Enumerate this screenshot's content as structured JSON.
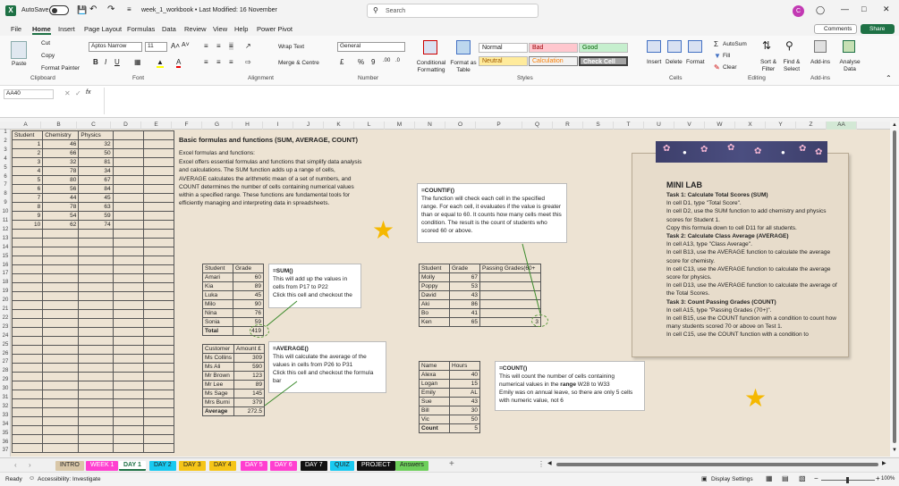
{
  "titlebar": {
    "autosave_label": "AutoSave",
    "autosave_state": "Off",
    "title": "week_1_workbook • Last Modified: 16 November",
    "search_placeholder": "Search",
    "avatar_initial": "C"
  },
  "menu": [
    "File",
    "Home",
    "Insert",
    "Page Layout",
    "Formulas",
    "Data",
    "Review",
    "View",
    "Help",
    "Power Pivot"
  ],
  "menu_active": "Home",
  "menu_right": {
    "comments": "Comments",
    "share": "Share"
  },
  "ribbon": {
    "clipboard": {
      "paste": "Paste",
      "cut": "Cut",
      "copy": "Copy",
      "format_painter": "Format Painter",
      "label": "Clipboard"
    },
    "font": {
      "name": "Aptos Narrow",
      "size": "11",
      "label": "Font"
    },
    "alignment": {
      "wrap": "Wrap Text",
      "merge": "Merge & Centre",
      "label": "Alignment"
    },
    "number": {
      "format": "General",
      "label": "Number"
    },
    "styles": {
      "cond": "Conditional Formatting",
      "table": "Format as Table",
      "normal": "Normal",
      "bad": "Bad",
      "good": "Good",
      "neutral": "Neutral",
      "calc": "Calculation",
      "check": "Check Cell",
      "label": "Styles"
    },
    "cells": {
      "insert": "Insert",
      "delete": "Delete",
      "format": "Format",
      "label": "Cells"
    },
    "editing": {
      "autosum": "AutoSum",
      "fill": "Fill",
      "clear": "Clear",
      "sort": "Sort & Filter",
      "find": "Find & Select",
      "label": "Editing"
    },
    "addins": {
      "addins": "Add-ins",
      "analyse": "Analyse Data",
      "label": "Add-ins"
    }
  },
  "formula_bar": {
    "name_box": "AA40",
    "fx": "fx",
    "value": ""
  },
  "columns": [
    "A",
    "B",
    "C",
    "D",
    "E",
    "F",
    "G",
    "H",
    "I",
    "J",
    "K",
    "L",
    "M",
    "N",
    "O",
    "P",
    "Q",
    "R",
    "S",
    "T",
    "U",
    "V",
    "W",
    "X",
    "Y",
    "Z",
    "AA"
  ],
  "rows": [
    "1",
    "2",
    "3",
    "4",
    "5",
    "6",
    "7",
    "8",
    "9",
    "10",
    "11",
    "12",
    "13",
    "14",
    "15",
    "16",
    "17",
    "18",
    "19",
    "20",
    "21",
    "22",
    "23",
    "24",
    "25",
    "26",
    "27",
    "28",
    "29",
    "30",
    "31",
    "32",
    "33",
    "34",
    "35",
    "36",
    "37"
  ],
  "table_main": {
    "headers": [
      "Student",
      "Chemistry",
      "Physics"
    ],
    "rows": [
      [
        "1",
        "46",
        "32"
      ],
      [
        "2",
        "66",
        "50"
      ],
      [
        "3",
        "32",
        "81"
      ],
      [
        "4",
        "78",
        "34"
      ],
      [
        "5",
        "80",
        "67"
      ],
      [
        "6",
        "56",
        "84"
      ],
      [
        "7",
        "44",
        "45"
      ],
      [
        "8",
        "78",
        "63"
      ],
      [
        "9",
        "54",
        "59"
      ],
      [
        "10",
        "62",
        "74"
      ]
    ]
  },
  "intro": {
    "title": "Basic formulas and functions (SUM, AVERAGE, COUNT)",
    "line1": "Excel formulas and functions:",
    "body": "Excel offers essential formulas and functions that simplify data analysis and calculations. The SUM function adds up a range of cells, AVERAGE calculates the arithmetic mean of a set of numbers, and COUNT determines the number of cells containing numerical values within a specified range. These functions are fundamental tools for efficiently managing and interpreting data in spreadsheets."
  },
  "sum_table": {
    "headers": [
      "Student",
      "Grade"
    ],
    "rows": [
      [
        "Amari",
        "60"
      ],
      [
        "Kia",
        "89"
      ],
      [
        "Luka",
        "45"
      ],
      [
        "Milo",
        "90"
      ],
      [
        "Nina",
        "76"
      ],
      [
        "Sonia",
        "59"
      ]
    ],
    "total_label": "Total",
    "total": "419"
  },
  "sum_note": {
    "title": "=SUM()",
    "body": "This will add up the values in cells from P17 to P22",
    "body2": "Click this cell and checkout the"
  },
  "avg_table": {
    "headers": [
      "Customer",
      "Amount £"
    ],
    "rows": [
      [
        "Ms Collins",
        "309"
      ],
      [
        "Ms Ali",
        "590"
      ],
      [
        "Mr Brown",
        "123"
      ],
      [
        "Mr Lee",
        "89"
      ],
      [
        "Ms Sage",
        "145"
      ],
      [
        "Mrs Burni",
        "379"
      ]
    ],
    "avg_label": "Average",
    "avg": "272.5"
  },
  "avg_note": {
    "title": "=AVERAGE()",
    "body": "This will calculate the average of the values in cells from P26 to P31",
    "body2": "Click this cell and checkout the formula bar"
  },
  "countif_note": {
    "title": "=COUNTIF()",
    "body": "The function will check each cell in the specified range. For each cell, it evaluates if the value is greater than or equal to 60. It counts how many cells meet this condition. The result is the count of students who scored 60 or above."
  },
  "countif_table": {
    "headers": [
      "Student",
      "Grade",
      "Passing Grades(60+"
    ],
    "rows": [
      [
        "Molly",
        "67"
      ],
      [
        "Poppy",
        "53"
      ],
      [
        "David",
        "43"
      ],
      [
        "Aki",
        "86"
      ],
      [
        "Bo",
        "41"
      ],
      [
        "Ken",
        "65"
      ]
    ],
    "result": "3"
  },
  "count_table": {
    "headers": [
      "Name",
      "Hours"
    ],
    "rows": [
      [
        "Alexa",
        "40"
      ],
      [
        "Logan",
        "15"
      ],
      [
        "Emily",
        "AL"
      ],
      [
        "Sue",
        "43"
      ],
      [
        "Bill",
        "30"
      ],
      [
        "Vic",
        "50"
      ]
    ],
    "count_label": "Count",
    "count": "5"
  },
  "count_note": {
    "title": "=COUNT()",
    "body1": "This will count the number of cells containing numerical values in the ",
    "range_word": "range",
    "body2": " W28 to W33",
    "body3": "Emily was on annual leave, so there are only 5 cells with numeric value, not 6"
  },
  "minilab": {
    "title": "MINI LAB",
    "lines": [
      {
        "t": "Task 1: Calculate Total Scores (SUM)",
        "b": true
      },
      {
        "t": "In cell D1, type \"Total Score\".",
        "b": false
      },
      {
        "t": "In cell D2, use the SUM function to add chemistry and physics scores for Student 1.",
        "b": false
      },
      {
        "t": "Copy this formula down to cell D11 for all students.",
        "b": false
      },
      {
        "t": "Task 2: Calculate Class Average (AVERAGE)",
        "b": true
      },
      {
        "t": "In cell A13, type \"Class Average\".",
        "b": false
      },
      {
        "t": "In cell B13, use the AVERAGE function to calculate the average score for chemisty.",
        "b": false
      },
      {
        "t": "In cell C13, use the AVERAGE function to calculate the average score for physics.",
        "b": false
      },
      {
        "t": "In cell D13, use the AVERAGE function to calculate the average of the Total Scores.",
        "b": false
      },
      {
        "t": "Task 3: Count Passing Grades (COUNT)",
        "b": true
      },
      {
        "t": "In cell A15, type \"Passing Grades (70+)\".",
        "b": false
      },
      {
        "t": "In cell B15, use the COUNT function with a condition to count how many students scored 70 or above on Test 1.",
        "b": false
      },
      {
        "t": "In cell C15, use the COUNT function with a condition to",
        "b": false
      }
    ]
  },
  "sheet_tabs": [
    {
      "label": "INTRO",
      "bg": "#d9c7a8",
      "fg": "#222"
    },
    {
      "label": "WEEK 1",
      "bg": "#ff3fd0",
      "fg": "#fff"
    },
    {
      "label": "DAY 1",
      "bg": "#ffffff",
      "fg": "#1e7145"
    },
    {
      "label": "DAY 2",
      "bg": "#19c9f0",
      "fg": "#222"
    },
    {
      "label": "DAY 3",
      "bg": "#f5c518",
      "fg": "#222"
    },
    {
      "label": "DAY 4",
      "bg": "#f5c518",
      "fg": "#222"
    },
    {
      "label": "DAY 5",
      "bg": "#ff3fd0",
      "fg": "#fff"
    },
    {
      "label": "DAY 6",
      "bg": "#ff3fd0",
      "fg": "#fff"
    },
    {
      "label": "DAY 7",
      "bg": "#111111",
      "fg": "#fff"
    },
    {
      "label": "QUIZ",
      "bg": "#19c9f0",
      "fg": "#222"
    },
    {
      "label": "PROJECT",
      "bg": "#111111",
      "fg": "#fff"
    },
    {
      "label": "Answers",
      "bg": "#6dcf5a",
      "fg": "#222"
    }
  ],
  "status": {
    "ready": "Ready",
    "accessibility": "Accessibility: Investigate",
    "display": "Display Settings",
    "zoom": "100%"
  }
}
